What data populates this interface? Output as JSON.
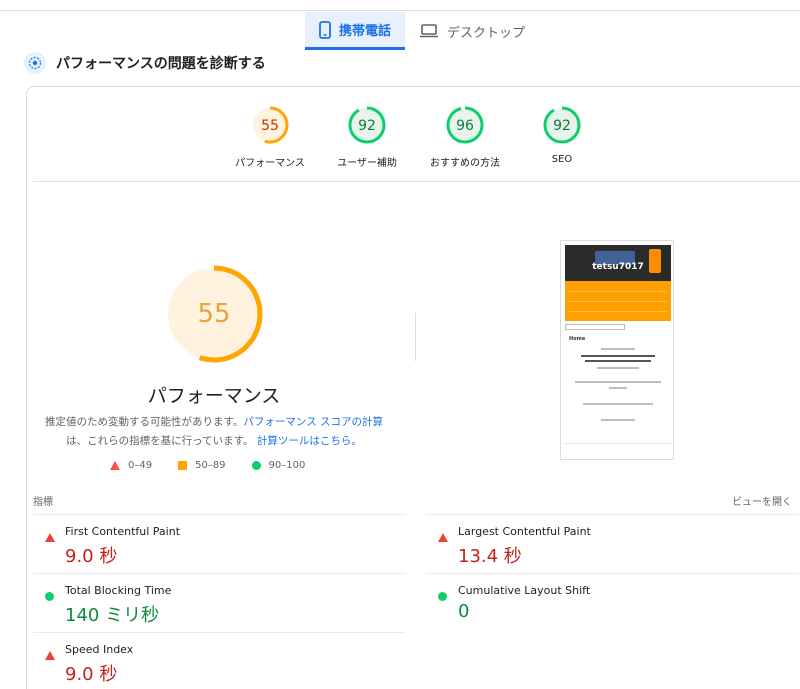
{
  "tabs": [
    {
      "label": "携帯電話",
      "icon": "smartphone-icon",
      "active": true
    },
    {
      "label": "デスクトップ",
      "icon": "laptop-icon",
      "active": false
    }
  ],
  "diagnose_title": "パフォーマンスの問題を診断する",
  "gauges": [
    {
      "score": "55",
      "label": "パフォーマンス",
      "value": 55,
      "status": "average"
    },
    {
      "score": "92",
      "label": "ユーザー補助",
      "value": 92,
      "status": "pass"
    },
    {
      "score": "96",
      "label": "おすすめの方法",
      "value": 96,
      "status": "pass"
    },
    {
      "score": "92",
      "label": "SEO",
      "value": 92,
      "status": "pass"
    }
  ],
  "main_gauge": {
    "score": "55",
    "value": 55,
    "title": "パフォーマンス"
  },
  "note": {
    "part1": "推定値のため変動する可能性があります。",
    "link1": "パフォーマンス スコアの計算",
    "part2": "は、これらの指標を基に行っています。",
    "link2": "計算ツールはこちら。"
  },
  "legend": {
    "fail": "0–49",
    "average": "50–89",
    "pass": "90–100"
  },
  "thumbnail": {
    "site_title": "tetsu7017",
    "heading": "Home"
  },
  "metrics_label": "指標",
  "expand_view": "ビューを開く",
  "metrics": [
    {
      "name": "First Contentful Paint",
      "value": "9.0 秒",
      "status": "fail"
    },
    {
      "name": "Largest Contentful Paint",
      "value": "13.4 秒",
      "status": "fail"
    },
    {
      "name": "Total Blocking Time",
      "value": "140 ミリ秒",
      "status": "pass"
    },
    {
      "name": "Cumulative Layout Shift",
      "value": "0",
      "status": "pass"
    },
    {
      "name": "Speed Index",
      "value": "9.0 秒",
      "status": "fail"
    }
  ],
  "colors": {
    "accent": "#1a73e8",
    "fail": "#ff4e42",
    "average": "#ffa400",
    "pass": "#0cce6b",
    "average_bg": "#fff3e0",
    "pass_bg": "#e6f4ea"
  }
}
